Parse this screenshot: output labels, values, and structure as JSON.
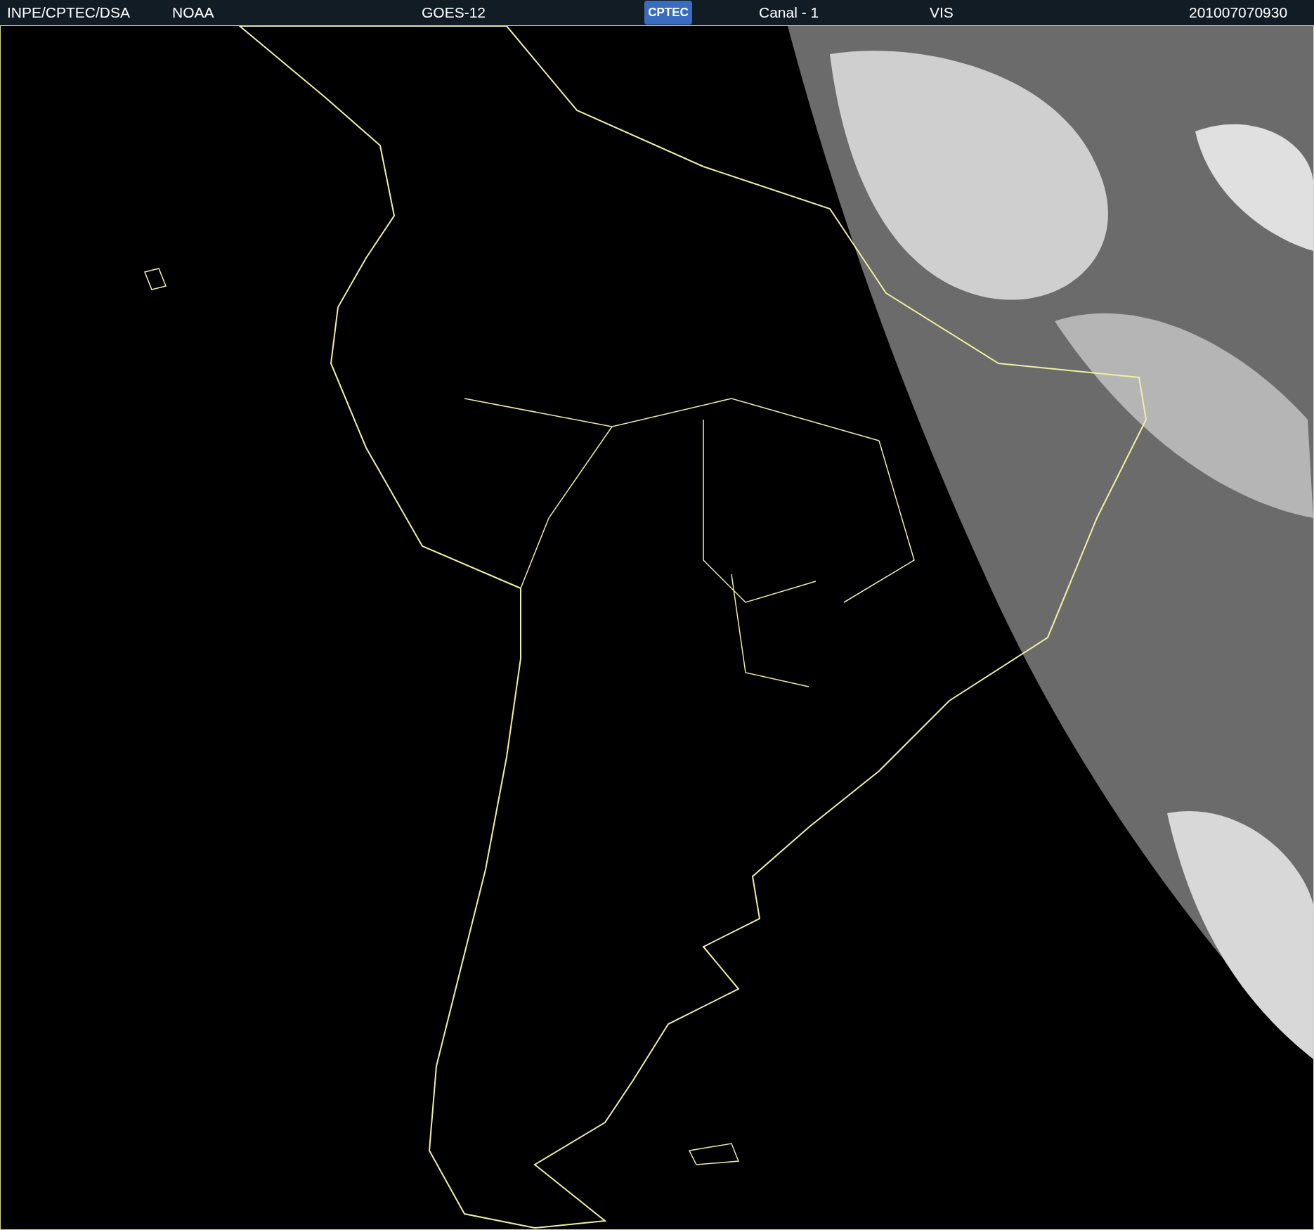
{
  "header": {
    "source": "INPE/CPTEC/DSA",
    "agency": "NOAA",
    "satellite": "GOES-12",
    "logo": "CPTEC",
    "channel": "Canal - 1",
    "band": "VIS",
    "timestamp": "201007070930"
  }
}
